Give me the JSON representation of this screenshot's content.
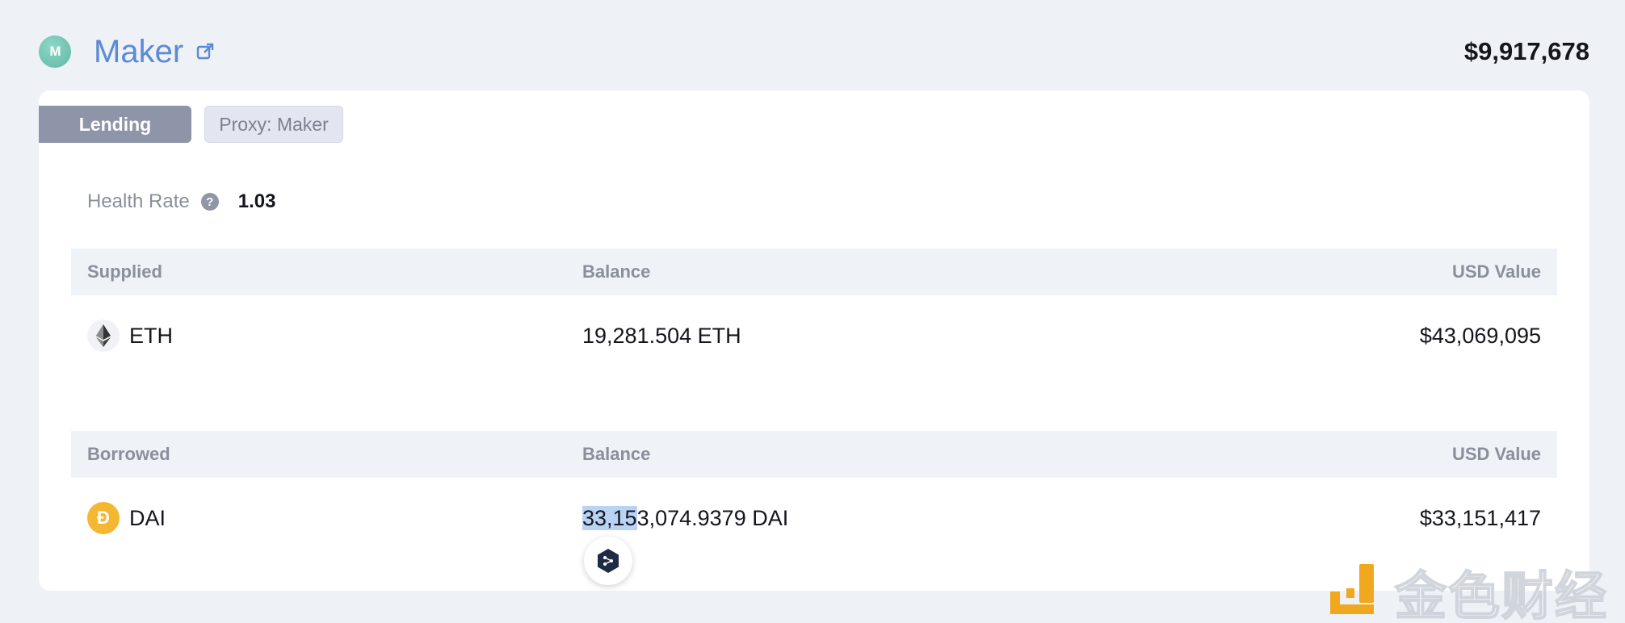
{
  "protocol": {
    "logo_glyph": "M",
    "name": "Maker",
    "total_value": "$9,917,678",
    "accent_color": "#5b8ad6"
  },
  "tags": {
    "lending": "Lending",
    "proxy": "Proxy: Maker"
  },
  "health": {
    "label": "Health Rate",
    "help_glyph": "?",
    "value": "1.03"
  },
  "supplied": {
    "headers": {
      "asset": "Supplied",
      "balance": "Balance",
      "usd": "USD Value"
    },
    "rows": [
      {
        "icon": "eth-icon",
        "token": "ETH",
        "balance": "19,281.504 ETH",
        "usd": "$43,069,095"
      }
    ]
  },
  "borrowed": {
    "headers": {
      "asset": "Borrowed",
      "balance": "Balance",
      "usd": "USD Value"
    },
    "rows": [
      {
        "icon": "dai-icon",
        "token": "DAI",
        "icon_glyph": "Ð",
        "balance_selected": "33,15",
        "balance_rest": "3,074.9379 DAI",
        "usd": "$33,151,417"
      }
    ]
  },
  "watermark": {
    "text": "金色财经"
  }
}
